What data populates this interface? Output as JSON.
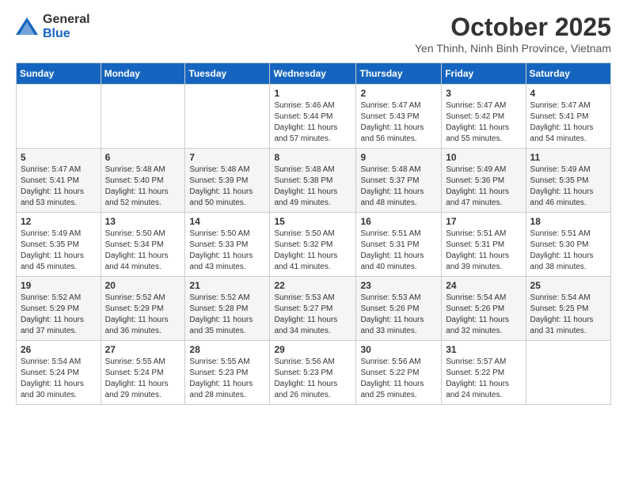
{
  "logo": {
    "general": "General",
    "blue": "Blue"
  },
  "header": {
    "month": "October 2025",
    "subtitle": "Yen Thinh, Ninh Binh Province, Vietnam"
  },
  "weekdays": [
    "Sunday",
    "Monday",
    "Tuesday",
    "Wednesday",
    "Thursday",
    "Friday",
    "Saturday"
  ],
  "weeks": [
    [
      {
        "day": "",
        "info": ""
      },
      {
        "day": "",
        "info": ""
      },
      {
        "day": "",
        "info": ""
      },
      {
        "day": "1",
        "info": "Sunrise: 5:46 AM\nSunset: 5:44 PM\nDaylight: 11 hours\nand 57 minutes."
      },
      {
        "day": "2",
        "info": "Sunrise: 5:47 AM\nSunset: 5:43 PM\nDaylight: 11 hours\nand 56 minutes."
      },
      {
        "day": "3",
        "info": "Sunrise: 5:47 AM\nSunset: 5:42 PM\nDaylight: 11 hours\nand 55 minutes."
      },
      {
        "day": "4",
        "info": "Sunrise: 5:47 AM\nSunset: 5:41 PM\nDaylight: 11 hours\nand 54 minutes."
      }
    ],
    [
      {
        "day": "5",
        "info": "Sunrise: 5:47 AM\nSunset: 5:41 PM\nDaylight: 11 hours\nand 53 minutes."
      },
      {
        "day": "6",
        "info": "Sunrise: 5:48 AM\nSunset: 5:40 PM\nDaylight: 11 hours\nand 52 minutes."
      },
      {
        "day": "7",
        "info": "Sunrise: 5:48 AM\nSunset: 5:39 PM\nDaylight: 11 hours\nand 50 minutes."
      },
      {
        "day": "8",
        "info": "Sunrise: 5:48 AM\nSunset: 5:38 PM\nDaylight: 11 hours\nand 49 minutes."
      },
      {
        "day": "9",
        "info": "Sunrise: 5:48 AM\nSunset: 5:37 PM\nDaylight: 11 hours\nand 48 minutes."
      },
      {
        "day": "10",
        "info": "Sunrise: 5:49 AM\nSunset: 5:36 PM\nDaylight: 11 hours\nand 47 minutes."
      },
      {
        "day": "11",
        "info": "Sunrise: 5:49 AM\nSunset: 5:35 PM\nDaylight: 11 hours\nand 46 minutes."
      }
    ],
    [
      {
        "day": "12",
        "info": "Sunrise: 5:49 AM\nSunset: 5:35 PM\nDaylight: 11 hours\nand 45 minutes."
      },
      {
        "day": "13",
        "info": "Sunrise: 5:50 AM\nSunset: 5:34 PM\nDaylight: 11 hours\nand 44 minutes."
      },
      {
        "day": "14",
        "info": "Sunrise: 5:50 AM\nSunset: 5:33 PM\nDaylight: 11 hours\nand 43 minutes."
      },
      {
        "day": "15",
        "info": "Sunrise: 5:50 AM\nSunset: 5:32 PM\nDaylight: 11 hours\nand 41 minutes."
      },
      {
        "day": "16",
        "info": "Sunrise: 5:51 AM\nSunset: 5:31 PM\nDaylight: 11 hours\nand 40 minutes."
      },
      {
        "day": "17",
        "info": "Sunrise: 5:51 AM\nSunset: 5:31 PM\nDaylight: 11 hours\nand 39 minutes."
      },
      {
        "day": "18",
        "info": "Sunrise: 5:51 AM\nSunset: 5:30 PM\nDaylight: 11 hours\nand 38 minutes."
      }
    ],
    [
      {
        "day": "19",
        "info": "Sunrise: 5:52 AM\nSunset: 5:29 PM\nDaylight: 11 hours\nand 37 minutes."
      },
      {
        "day": "20",
        "info": "Sunrise: 5:52 AM\nSunset: 5:29 PM\nDaylight: 11 hours\nand 36 minutes."
      },
      {
        "day": "21",
        "info": "Sunrise: 5:52 AM\nSunset: 5:28 PM\nDaylight: 11 hours\nand 35 minutes."
      },
      {
        "day": "22",
        "info": "Sunrise: 5:53 AM\nSunset: 5:27 PM\nDaylight: 11 hours\nand 34 minutes."
      },
      {
        "day": "23",
        "info": "Sunrise: 5:53 AM\nSunset: 5:26 PM\nDaylight: 11 hours\nand 33 minutes."
      },
      {
        "day": "24",
        "info": "Sunrise: 5:54 AM\nSunset: 5:26 PM\nDaylight: 11 hours\nand 32 minutes."
      },
      {
        "day": "25",
        "info": "Sunrise: 5:54 AM\nSunset: 5:25 PM\nDaylight: 11 hours\nand 31 minutes."
      }
    ],
    [
      {
        "day": "26",
        "info": "Sunrise: 5:54 AM\nSunset: 5:24 PM\nDaylight: 11 hours\nand 30 minutes."
      },
      {
        "day": "27",
        "info": "Sunrise: 5:55 AM\nSunset: 5:24 PM\nDaylight: 11 hours\nand 29 minutes."
      },
      {
        "day": "28",
        "info": "Sunrise: 5:55 AM\nSunset: 5:23 PM\nDaylight: 11 hours\nand 28 minutes."
      },
      {
        "day": "29",
        "info": "Sunrise: 5:56 AM\nSunset: 5:23 PM\nDaylight: 11 hours\nand 26 minutes."
      },
      {
        "day": "30",
        "info": "Sunrise: 5:56 AM\nSunset: 5:22 PM\nDaylight: 11 hours\nand 25 minutes."
      },
      {
        "day": "31",
        "info": "Sunrise: 5:57 AM\nSunset: 5:22 PM\nDaylight: 11 hours\nand 24 minutes."
      },
      {
        "day": "",
        "info": ""
      }
    ]
  ]
}
